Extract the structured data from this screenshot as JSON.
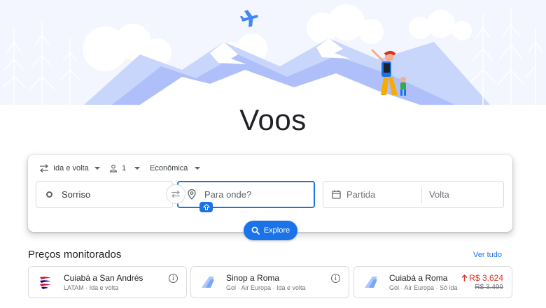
{
  "header": {
    "title": "Voos"
  },
  "options": {
    "trip_type": "Ida e volta",
    "passengers": "1",
    "cabin_class": "Econômica"
  },
  "search": {
    "origin": "Sorriso",
    "destination_placeholder": "Para onde?",
    "departure_placeholder": "Partida",
    "return_placeholder": "Volta",
    "explore_label": "Explore"
  },
  "tracked": {
    "title": "Preços monitorados",
    "see_all": "Ver tudo",
    "items": [
      {
        "route": "Cuiabá a San Andrés",
        "details": "LATAM · Ida e volta"
      },
      {
        "route": "Sinop a Roma",
        "details": "Gol · Air Europa · Ida e volta"
      },
      {
        "route": "Cuiabá a Roma",
        "details": "Gol · Air Europa · Só ida",
        "price_new": "R$ 3.624",
        "price_old": "R$ 3.499"
      }
    ]
  },
  "colors": {
    "accent": "#1a73e8",
    "price_up": "#d93025",
    "hero_blue": "#c8d6fb"
  }
}
